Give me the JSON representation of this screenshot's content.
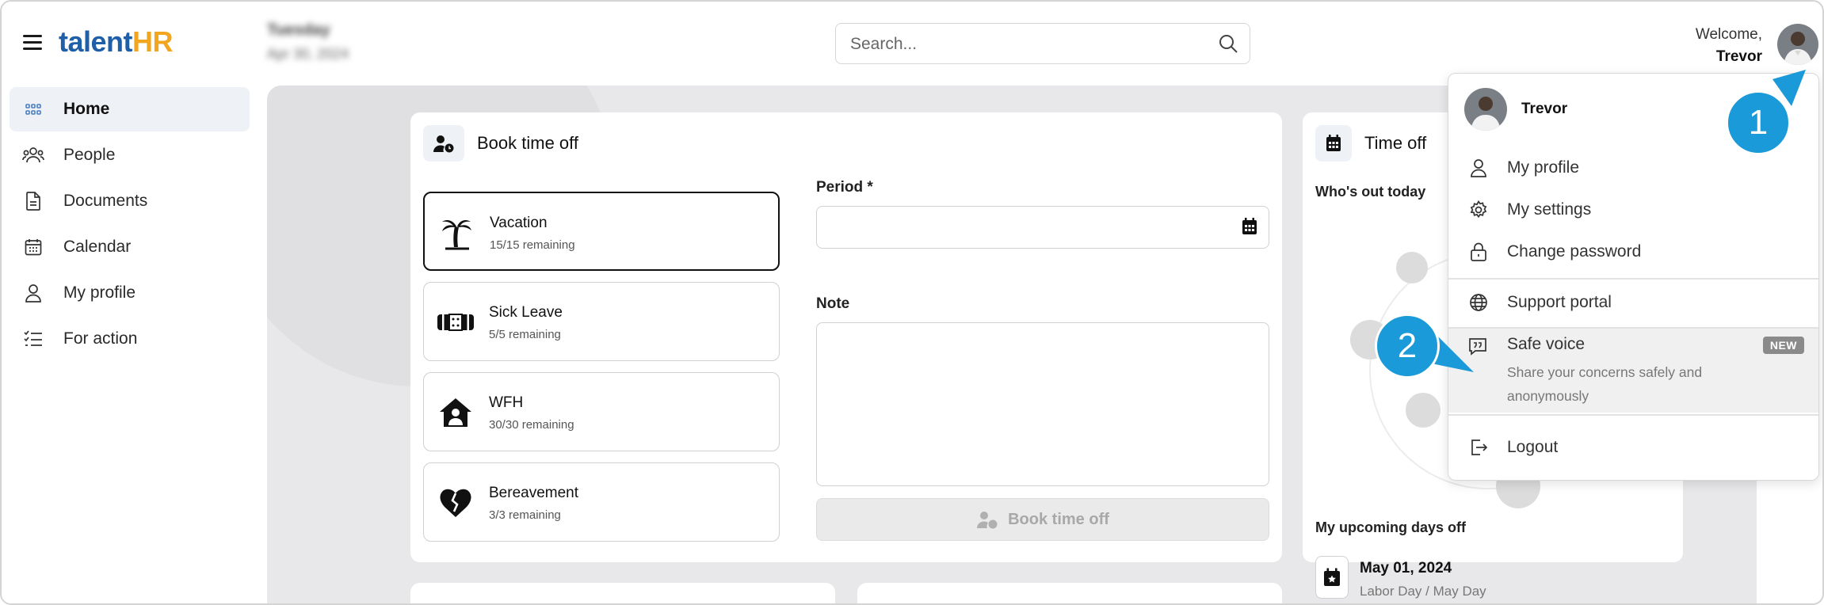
{
  "app": {
    "logo_part1": "talent",
    "logo_part2": "HR"
  },
  "header": {
    "date_line1": "Tuesday",
    "date_line2": "Apr 30, 2024",
    "search_placeholder": "Search...",
    "welcome_label": "Welcome,",
    "user_name": "Trevor"
  },
  "sidebar": {
    "items": [
      {
        "label": "Home",
        "icon": "grid-icon",
        "active": true
      },
      {
        "label": "People",
        "icon": "people-icon"
      },
      {
        "label": "Documents",
        "icon": "document-icon"
      },
      {
        "label": "Calendar",
        "icon": "calendar-icon"
      },
      {
        "label": "My profile",
        "icon": "user-icon"
      },
      {
        "label": "For action",
        "icon": "checklist-icon"
      }
    ]
  },
  "book_time_off": {
    "title": "Book time off",
    "types": [
      {
        "name": "Vacation",
        "remaining": "15/15 remaining",
        "icon": "palm-tree-icon",
        "selected": true
      },
      {
        "name": "Sick Leave",
        "remaining": "5/5 remaining",
        "icon": "bandage-icon"
      },
      {
        "name": "WFH",
        "remaining": "30/30 remaining",
        "icon": "house-user-icon"
      },
      {
        "name": "Bereavement",
        "remaining": "3/3 remaining",
        "icon": "broken-heart-icon"
      }
    ],
    "period_label": "Period *",
    "note_label": "Note",
    "button_label": "Book time off"
  },
  "time_off": {
    "title": "Time off",
    "whos_out": "Who's out today",
    "upcoming_label": "My upcoming days off",
    "upcoming": [
      {
        "date": "May 01, 2024",
        "name": "Labor Day / May Day"
      }
    ]
  },
  "dropdown": {
    "user_name": "Trevor",
    "items": [
      {
        "label": "My profile",
        "icon": "user-icon"
      },
      {
        "label": "My settings",
        "icon": "gear-icon"
      },
      {
        "label": "Change password",
        "icon": "lock-icon"
      },
      {
        "label": "Support portal",
        "icon": "globe-icon"
      }
    ],
    "safe_voice": {
      "label": "Safe voice",
      "description": "Share your concerns safely and anonymously",
      "badge": "NEW",
      "icon": "quote-bubble-icon"
    },
    "logout": {
      "label": "Logout",
      "icon": "logout-icon"
    }
  },
  "callouts": [
    "1",
    "2"
  ],
  "colors": {
    "accent": "#1a9ad8",
    "brand_blue": "#1e5fa8",
    "brand_orange": "#f2a51f"
  }
}
